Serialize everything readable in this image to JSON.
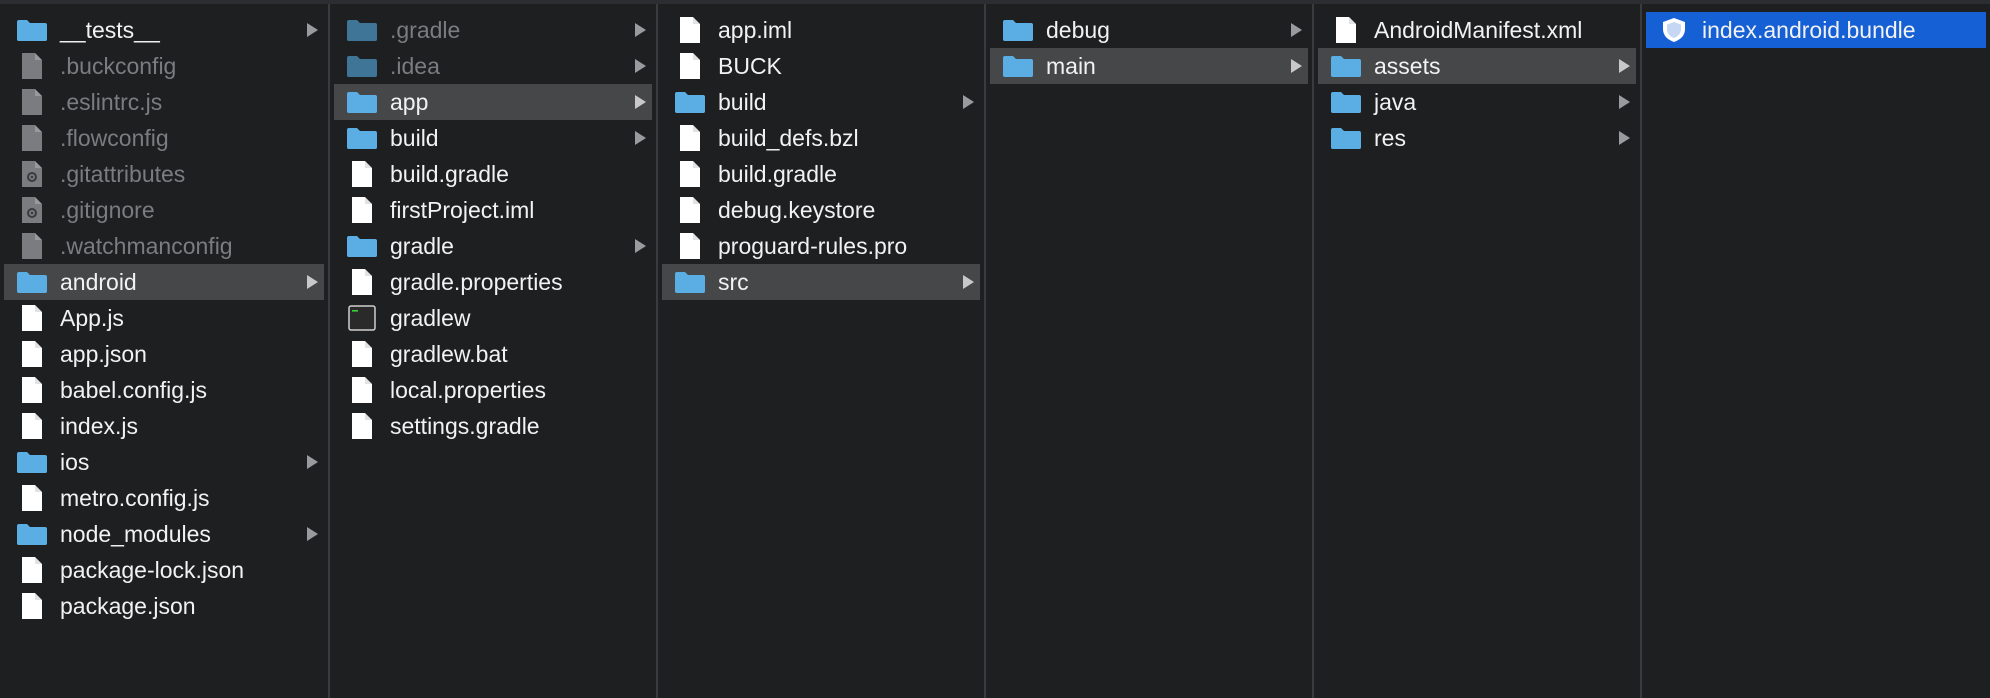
{
  "colors": {
    "background": "#1e1f21",
    "active_row": "#464749",
    "selected_row": "#1660d6",
    "folder": "#5aaee3",
    "folder_hidden": "#3f7597",
    "file": "#ffffff",
    "file_hidden": "#7b7c7f",
    "text": "#f2f2f2",
    "text_hidden": "#7b7c7f"
  },
  "columns": [
    {
      "items": [
        {
          "name": "__tests__",
          "icon": "folder-icon",
          "folder": true
        },
        {
          "name": ".buckconfig",
          "icon": "file-icon",
          "hidden": true
        },
        {
          "name": ".eslintrc.js",
          "icon": "file-icon",
          "hidden": true
        },
        {
          "name": ".flowconfig",
          "icon": "file-icon",
          "hidden": true
        },
        {
          "name": ".gitattributes",
          "icon": "gear-file-icon",
          "hidden": true
        },
        {
          "name": ".gitignore",
          "icon": "gear-file-icon",
          "hidden": true
        },
        {
          "name": ".watchmanconfig",
          "icon": "file-icon",
          "hidden": true
        },
        {
          "name": "android",
          "icon": "folder-icon",
          "folder": true,
          "state": "active"
        },
        {
          "name": "App.js",
          "icon": "file-icon"
        },
        {
          "name": "app.json",
          "icon": "file-icon"
        },
        {
          "name": "babel.config.js",
          "icon": "file-icon"
        },
        {
          "name": "index.js",
          "icon": "file-icon"
        },
        {
          "name": "ios",
          "icon": "folder-icon",
          "folder": true
        },
        {
          "name": "metro.config.js",
          "icon": "file-icon"
        },
        {
          "name": "node_modules",
          "icon": "folder-icon",
          "folder": true
        },
        {
          "name": "package-lock.json",
          "icon": "file-icon"
        },
        {
          "name": "package.json",
          "icon": "file-icon"
        }
      ]
    },
    {
      "items": [
        {
          "name": ".gradle",
          "icon": "folder-icon",
          "folder": true,
          "hidden": true
        },
        {
          "name": ".idea",
          "icon": "folder-icon",
          "folder": true,
          "hidden": true
        },
        {
          "name": "app",
          "icon": "folder-icon",
          "folder": true,
          "state": "active"
        },
        {
          "name": "build",
          "icon": "folder-icon",
          "folder": true
        },
        {
          "name": "build.gradle",
          "icon": "file-icon"
        },
        {
          "name": "firstProject.iml",
          "icon": "file-icon"
        },
        {
          "name": "gradle",
          "icon": "folder-icon",
          "folder": true
        },
        {
          "name": "gradle.properties",
          "icon": "file-icon"
        },
        {
          "name": "gradlew",
          "icon": "terminal-icon"
        },
        {
          "name": "gradlew.bat",
          "icon": "file-icon"
        },
        {
          "name": "local.properties",
          "icon": "file-icon"
        },
        {
          "name": "settings.gradle",
          "icon": "file-icon"
        }
      ]
    },
    {
      "items": [
        {
          "name": "app.iml",
          "icon": "file-icon"
        },
        {
          "name": "BUCK",
          "icon": "file-icon"
        },
        {
          "name": "build",
          "icon": "folder-icon",
          "folder": true
        },
        {
          "name": "build_defs.bzl",
          "icon": "file-icon"
        },
        {
          "name": "build.gradle",
          "icon": "file-icon"
        },
        {
          "name": "debug.keystore",
          "icon": "file-icon"
        },
        {
          "name": "proguard-rules.pro",
          "icon": "file-icon"
        },
        {
          "name": "src",
          "icon": "folder-icon",
          "folder": true,
          "state": "active"
        }
      ]
    },
    {
      "items": [
        {
          "name": "debug",
          "icon": "folder-icon",
          "folder": true
        },
        {
          "name": "main",
          "icon": "folder-icon",
          "folder": true,
          "state": "active"
        }
      ]
    },
    {
      "items": [
        {
          "name": "AndroidManifest.xml",
          "icon": "file-icon"
        },
        {
          "name": "assets",
          "icon": "folder-icon",
          "folder": true,
          "state": "active"
        },
        {
          "name": "java",
          "icon": "folder-icon",
          "folder": true
        },
        {
          "name": "res",
          "icon": "folder-icon",
          "folder": true
        }
      ]
    },
    {
      "items": [
        {
          "name": "index.android.bundle",
          "icon": "shield-icon",
          "state": "selected"
        }
      ]
    }
  ]
}
